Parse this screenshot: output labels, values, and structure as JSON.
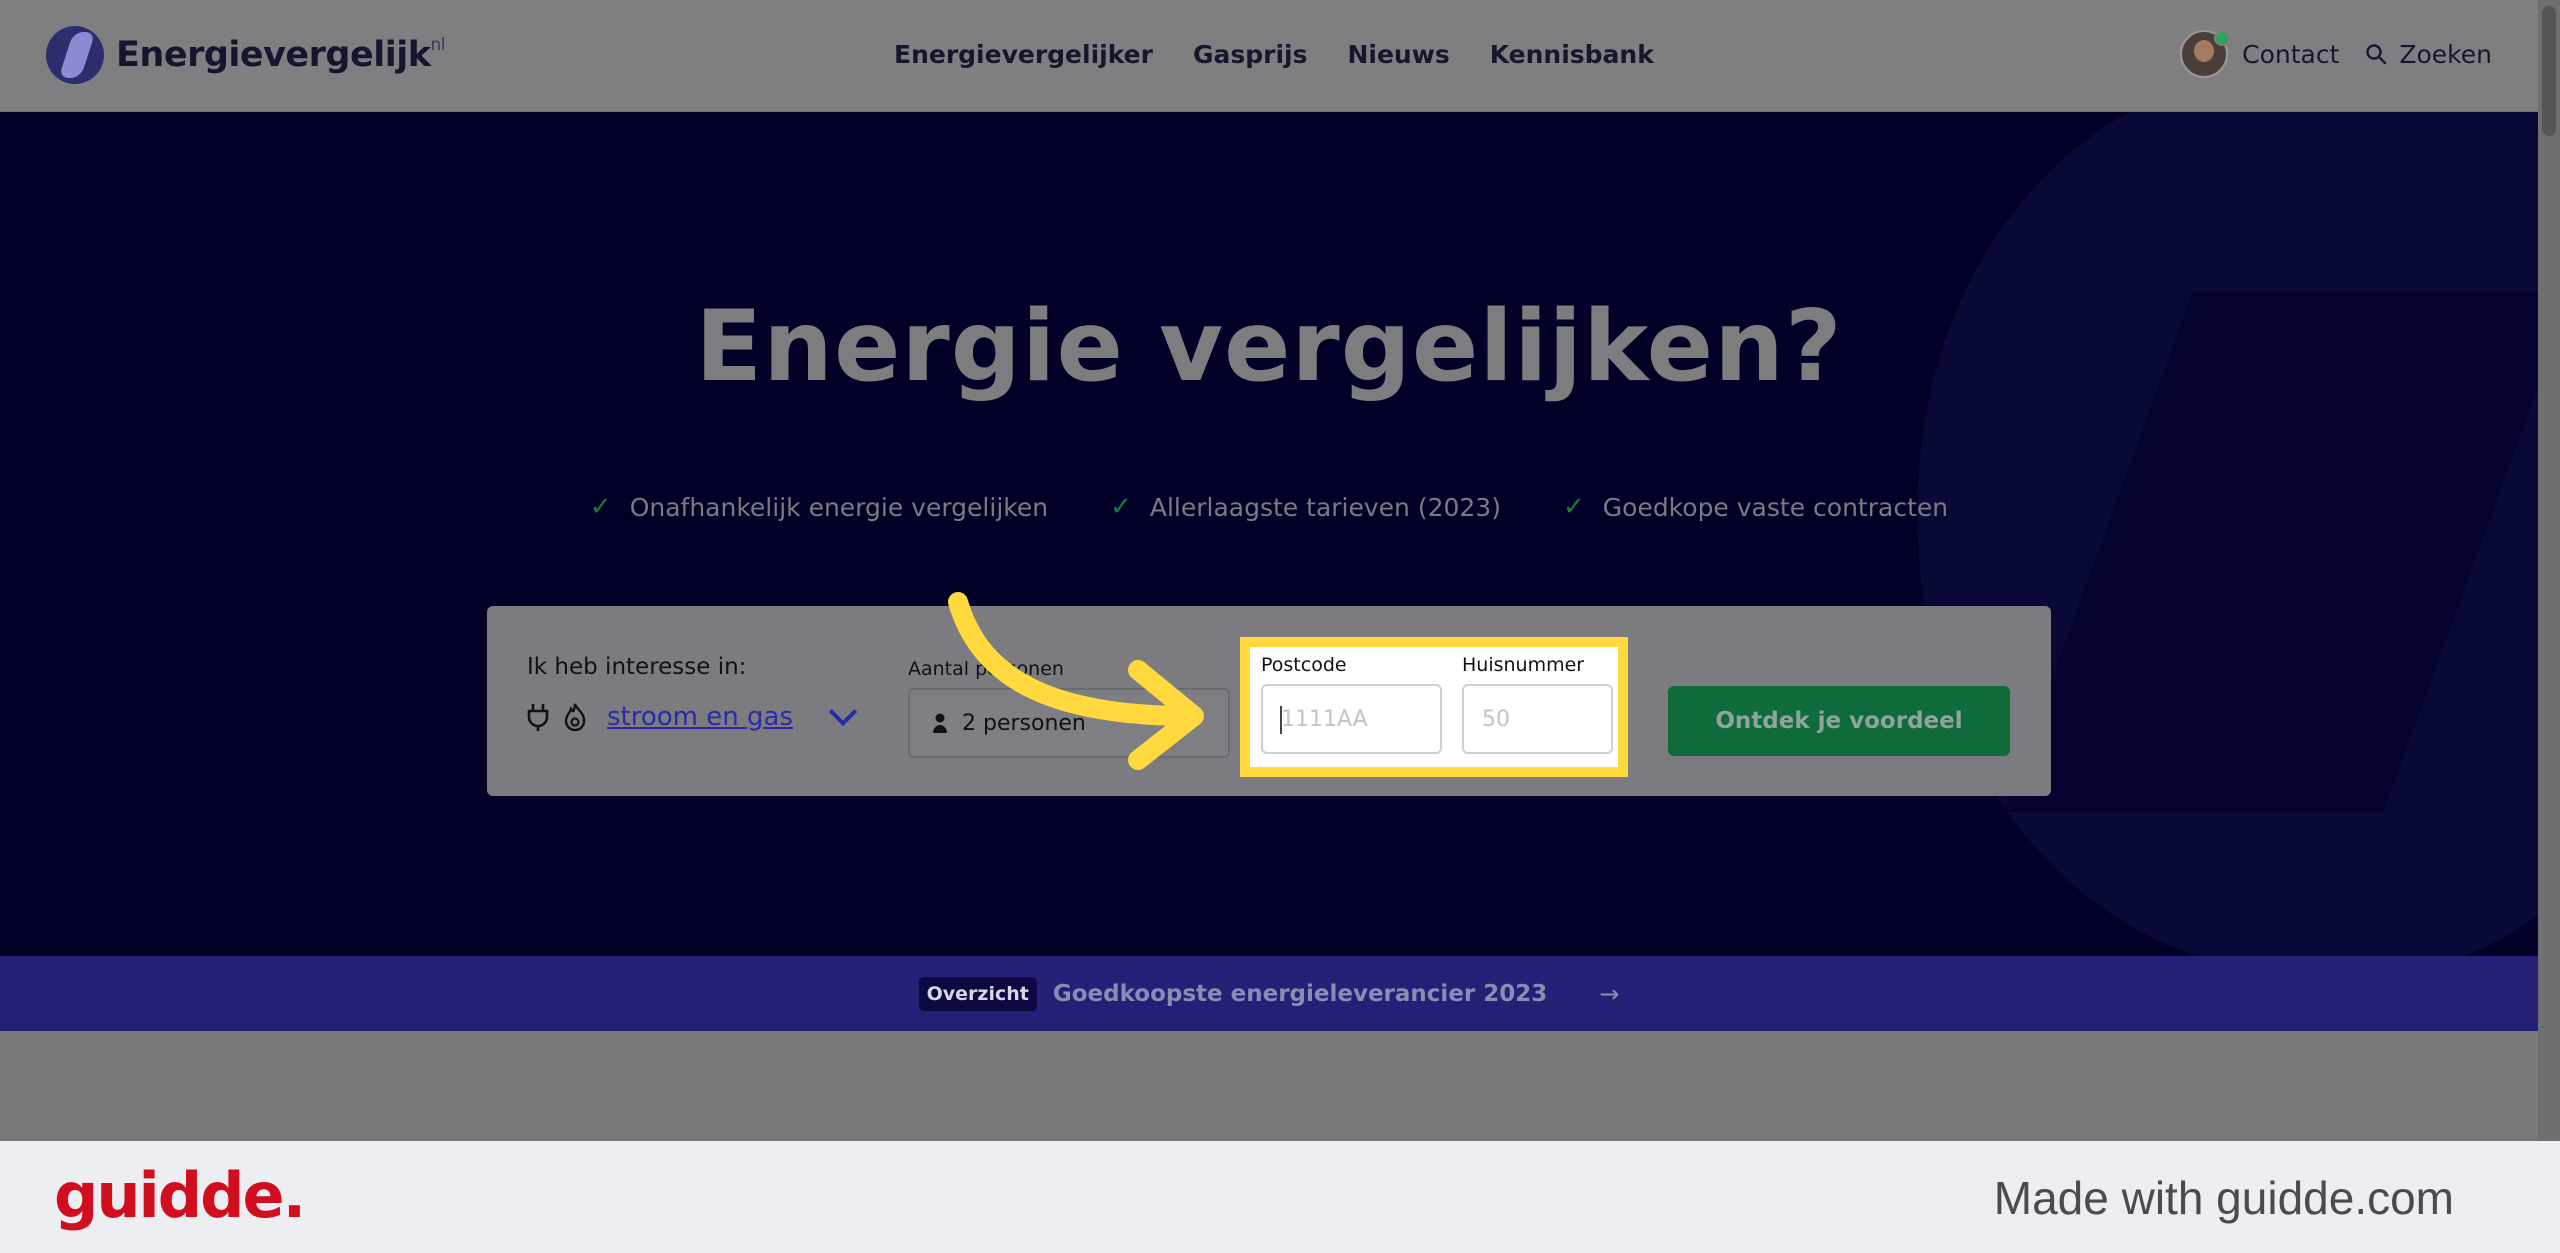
{
  "header": {
    "logo_text": "Energievergelijk",
    "logo_suffix": "nl",
    "nav": [
      "Energievergelijker",
      "Gasprijs",
      "Nieuws",
      "Kennisbank"
    ],
    "contact_label": "Contact",
    "search_label": "Zoeken"
  },
  "hero": {
    "title": "Energie vergelijken?",
    "usps": [
      "Onafhankelijk energie vergelijken",
      "Allerlaagste tarieven (2023)",
      "Goedkope vaste contracten"
    ]
  },
  "form": {
    "interest_label": "Ik heb interesse in:",
    "interest_value": "stroom en gas",
    "persons_label": "Aantal personen",
    "persons_value": "2 personen",
    "postcode_label": "Postcode",
    "postcode_placeholder": "1111AA",
    "huisnummer_label": "Huisnummer",
    "huisnummer_placeholder": "50",
    "cta_label": "Ontdek je voordeel"
  },
  "banner": {
    "badge": "Overzicht",
    "text": "Goedkoopste energieleverancier 2023"
  },
  "footer": {
    "brand": "guidde.",
    "made_with": "Made with guidde.com"
  },
  "colors": {
    "hero_bg": "#020027",
    "highlight": "#ffd93d",
    "cta": "#0f6b3a",
    "banner": "#232076",
    "guidde_red": "#d20d1d"
  }
}
